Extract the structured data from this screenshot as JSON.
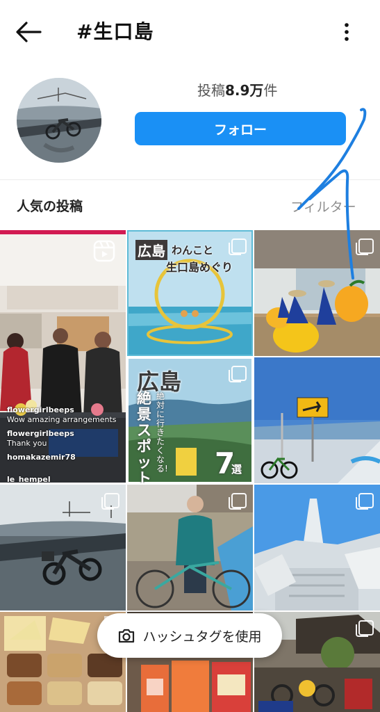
{
  "header": {
    "title": "#生口島"
  },
  "profile": {
    "posts_label_prefix": "投稿",
    "posts_count": "8.9万",
    "posts_label_suffix": "件",
    "follow_label": "フォロー"
  },
  "section": {
    "title": "人気の投稿",
    "filter_label": "フィルター"
  },
  "tiles": {
    "t1": {
      "comments": [
        {
          "user": "flowergirlbeeps",
          "text": "Wow amazing arrangements"
        },
        {
          "user": "flowergirlbeeps",
          "text": "Thank you"
        },
        {
          "user": "homakazemir78",
          "text": ""
        },
        {
          "user": "le_hempel",
          "text": ""
        }
      ]
    },
    "t2": {
      "line1": "広島",
      "line2": "わんこと",
      "line3": "生口島めぐり"
    },
    "t5": {
      "big": "広島",
      "vertical1": "絶景スポット",
      "vertical2": "絶対に行きたくなる!",
      "count": "7",
      "count_suffix": "選"
    }
  },
  "hashtag_button": {
    "label": "ハッシュタグを使用"
  },
  "colors": {
    "accent": "#1a90f5",
    "annotation": "#1e7fe0"
  }
}
